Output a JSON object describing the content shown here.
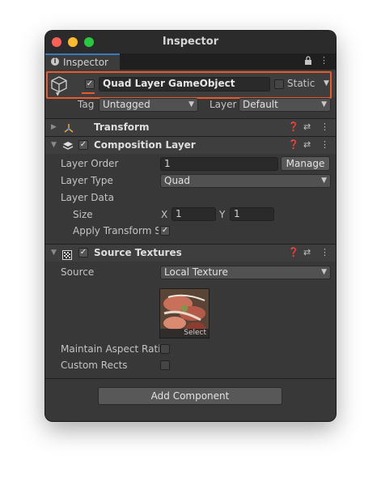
{
  "window": {
    "title": "Inspector"
  },
  "tab": {
    "label": "Inspector",
    "icon": "info-icon"
  },
  "gameobject": {
    "enabled": true,
    "name": "Quad Layer GameObject",
    "static_label": "Static",
    "tag_label": "Tag",
    "tag_value": "Untagged",
    "layer_label": "Layer",
    "layer_value": "Default",
    "highlight_color": "#e8592b"
  },
  "components": {
    "transform": {
      "title": "Transform"
    },
    "composition_layer": {
      "title": "Composition Layer",
      "enabled": true,
      "layer_order_label": "Layer Order",
      "layer_order_value": "1",
      "manage_label": "Manage",
      "layer_type_label": "Layer Type",
      "layer_type_value": "Quad",
      "layer_data_label": "Layer Data",
      "size_label": "Size",
      "size_x_label": "X",
      "size_x_value": "1",
      "size_y_label": "Y",
      "size_y_value": "1",
      "apply_transform_label": "Apply Transform Sc",
      "apply_transform_checked": true
    },
    "source_textures": {
      "title": "Source Textures",
      "enabled": true,
      "source_label": "Source",
      "source_value": "Local Texture",
      "texture_select_label": "Select",
      "maintain_aspect_label": "Maintain Aspect Ratio",
      "custom_rects_label": "Custom Rects"
    }
  },
  "add_component_label": "Add Component",
  "icons": [
    "lock-icon",
    "kebab-menu-icon",
    "cube-icon",
    "help-icon",
    "presets-icon",
    "checker-icon",
    "transform-axes-icon",
    "layers-icon"
  ]
}
